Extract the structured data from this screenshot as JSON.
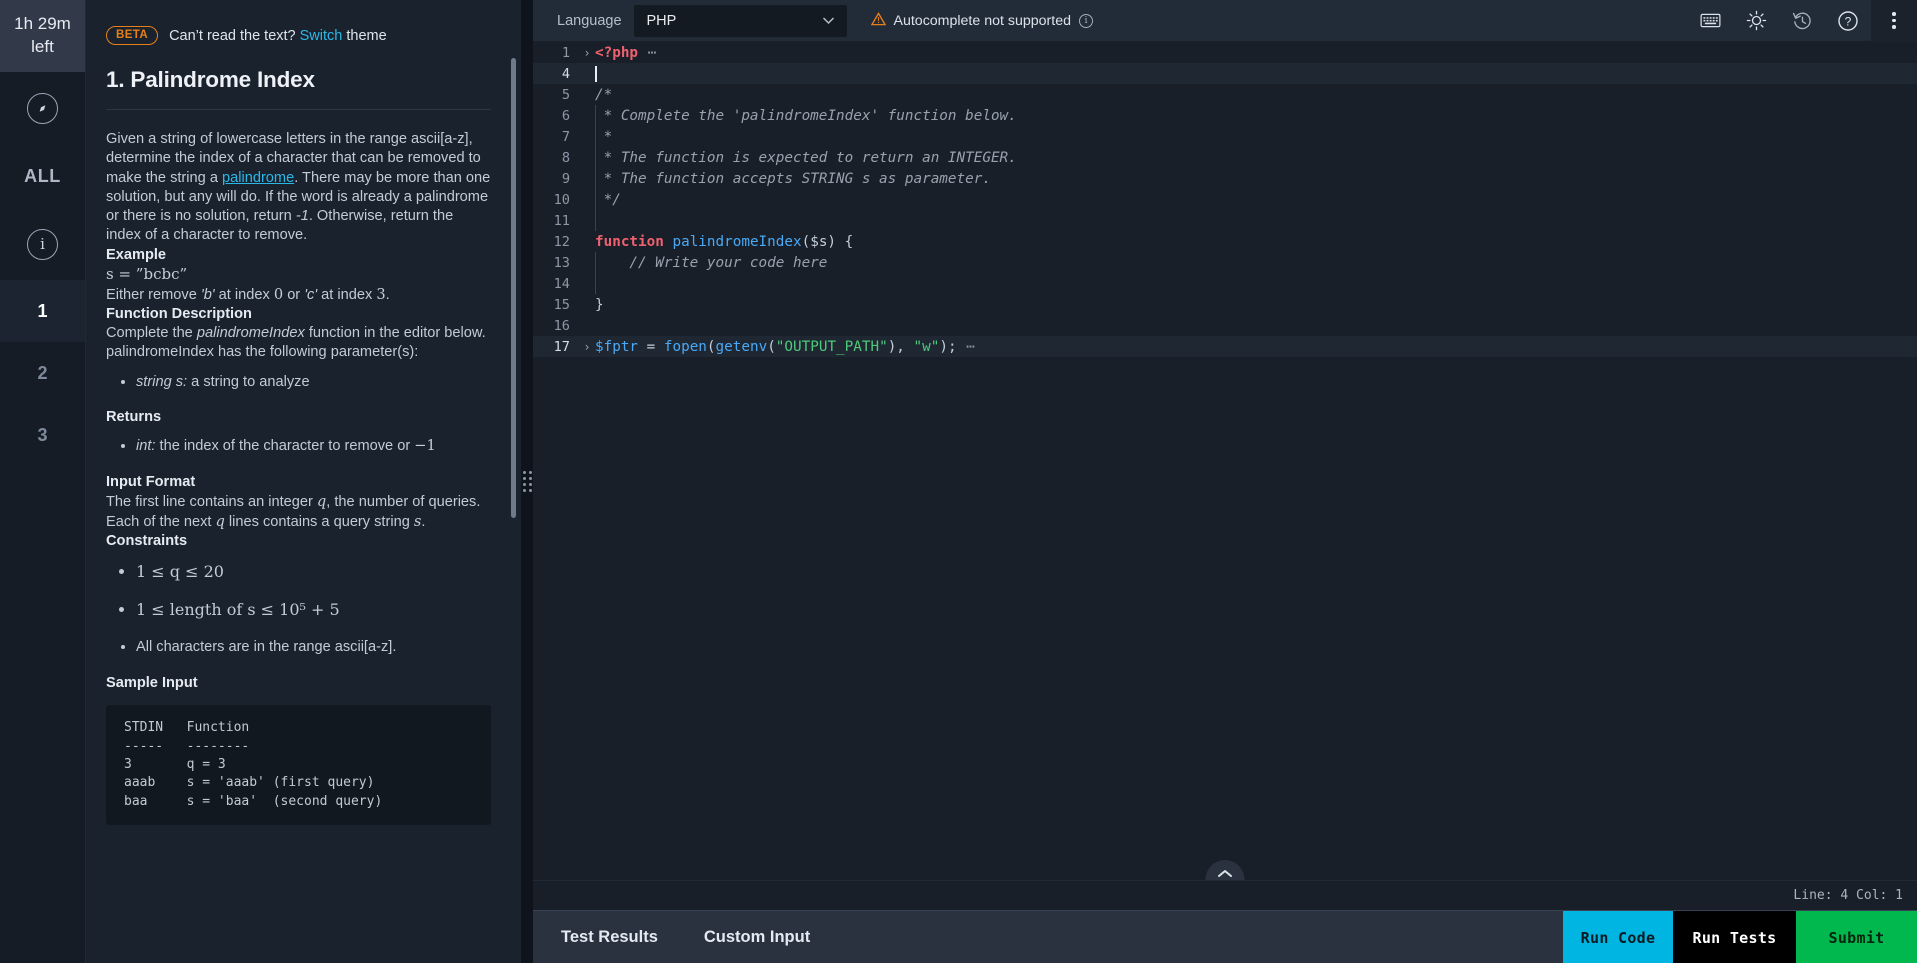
{
  "rail": {
    "timer": "1h 29m\nleft",
    "compass_icon": "compass-icon",
    "all_label": "ALL",
    "info_icon": "info-icon",
    "questions": [
      {
        "label": "1",
        "active": true
      },
      {
        "label": "2",
        "active": false
      },
      {
        "label": "3",
        "active": false
      }
    ]
  },
  "problem": {
    "beta_badge": "BETA",
    "beta_prefix": "Can’t read the text? ",
    "beta_link": "Switch",
    "beta_suffix": " theme",
    "title": "1. Palindrome Index",
    "intro_a": "Given a string of lowercase letters in the range ascii[a-z], determine the index of a character that can be removed to make the string a ",
    "intro_link": "palindrome",
    "intro_b": ". There may be more than one solution, but any will do. If the word is already a palindrome or there is no solution, return ",
    "intro_neg1": "-1",
    "intro_c": ". Otherwise, return the index of a character to remove.",
    "example_heading": "Example",
    "example_eq": "s = ”bcbc”",
    "example_text_a": "Either remove ",
    "example_b_char": "'b'",
    "example_text_b": " at index ",
    "example_idx0": "0",
    "example_text_c": " or ",
    "example_c_char": "'c'",
    "example_text_d": " at index ",
    "example_idx3": "3",
    "example_text_e": ".",
    "funcdesc_heading": "Function Description",
    "funcdesc_a": "Complete the ",
    "funcdesc_fn": "palindromeIndex",
    "funcdesc_b": " function in the editor below. palindromeIndex has the following parameter(s):",
    "param_em": "string s:",
    "param_rest": " a string to analyze",
    "returns_heading": "Returns",
    "returns_em": "int:",
    "returns_rest": " the index of the character to remove or ",
    "returns_val": "−1",
    "inputformat_heading": "Input Format",
    "inputformat_a": "The first line contains an integer ",
    "inputformat_q1": "q",
    "inputformat_b": ", the number of queries. Each of the next ",
    "inputformat_q2": "q",
    "inputformat_c": " lines contains a query string ",
    "inputformat_s": "s",
    "inputformat_d": ".",
    "constraints_heading": "Constraints",
    "constraint_1": "1 ≤ q ≤ 20",
    "constraint_2": "1 ≤ length of s ≤ 10⁵ + 5",
    "constraint_3": "All characters are in the range ascii[a-z].",
    "sampleinput_heading": "Sample Input",
    "sample_code": "STDIN   Function\n-----   --------\n3       q = 3\naaab    s = 'aaab' (first query)\nbaa     s = 'baa'  (second query)"
  },
  "editor": {
    "language_label": "Language",
    "language_value": "PHP",
    "autocomplete_warning": "Autocomplete not supported",
    "warning_icon": "warning-triangle-icon",
    "info_icon": "info-circle-icon",
    "toolbar_icons": [
      "keyboard-icon",
      "brightness-icon",
      "history-icon",
      "help-icon",
      "kebab-menu-icon"
    ],
    "code": [
      {
        "num": "1",
        "fold": "›",
        "highlight": false,
        "indent": false,
        "tokens": [
          {
            "t": "kw",
            "v": "<?php"
          },
          {
            "t": "dots",
            "v": " ⋯"
          }
        ]
      },
      {
        "num": "4",
        "fold": "",
        "highlight": true,
        "indent": false,
        "cursor": true,
        "tokens": []
      },
      {
        "num": "5",
        "fold": "",
        "highlight": false,
        "indent": false,
        "tokens": [
          {
            "t": "cm",
            "v": "/*"
          }
        ]
      },
      {
        "num": "6",
        "fold": "",
        "highlight": false,
        "indent": true,
        "tokens": [
          {
            "t": "cm",
            "v": " * Complete the 'palindromeIndex' function below."
          }
        ]
      },
      {
        "num": "7",
        "fold": "",
        "highlight": false,
        "indent": true,
        "tokens": [
          {
            "t": "cm",
            "v": " *"
          }
        ]
      },
      {
        "num": "8",
        "fold": "",
        "highlight": false,
        "indent": true,
        "tokens": [
          {
            "t": "cm",
            "v": " * The function is expected to return an INTEGER."
          }
        ]
      },
      {
        "num": "9",
        "fold": "",
        "highlight": false,
        "indent": true,
        "tokens": [
          {
            "t": "cm",
            "v": " * The function accepts STRING s as parameter."
          }
        ]
      },
      {
        "num": "10",
        "fold": "",
        "highlight": false,
        "indent": true,
        "tokens": [
          {
            "t": "cm",
            "v": " */"
          }
        ]
      },
      {
        "num": "11",
        "fold": "",
        "highlight": false,
        "indent": true,
        "tokens": []
      },
      {
        "num": "12",
        "fold": "",
        "highlight": false,
        "indent": false,
        "tokens": [
          {
            "t": "kw",
            "v": "function"
          },
          {
            "t": "var",
            "v": " "
          },
          {
            "t": "fn",
            "v": "palindromeIndex"
          },
          {
            "t": "var",
            "v": "($s) {"
          }
        ]
      },
      {
        "num": "13",
        "fold": "",
        "highlight": false,
        "indent": true,
        "tokens": [
          {
            "t": "cm",
            "v": "    // Write your code here"
          }
        ]
      },
      {
        "num": "14",
        "fold": "",
        "highlight": false,
        "indent": true,
        "tokens": []
      },
      {
        "num": "15",
        "fold": "",
        "highlight": false,
        "indent": false,
        "tokens": [
          {
            "t": "var",
            "v": "}"
          }
        ]
      },
      {
        "num": "16",
        "fold": "",
        "highlight": false,
        "indent": false,
        "tokens": []
      },
      {
        "num": "17",
        "fold": "›",
        "highlight": true,
        "indent": false,
        "tokens": [
          {
            "t": "fn",
            "v": "$fptr"
          },
          {
            "t": "var",
            "v": " = "
          },
          {
            "t": "fn",
            "v": "fopen"
          },
          {
            "t": "var",
            "v": "("
          },
          {
            "t": "fn",
            "v": "getenv"
          },
          {
            "t": "var",
            "v": "("
          },
          {
            "t": "str",
            "v": "\"OUTPUT_PATH\""
          },
          {
            "t": "var",
            "v": "), "
          },
          {
            "t": "str",
            "v": "\"w\""
          },
          {
            "t": "var",
            "v": ");"
          },
          {
            "t": "dots",
            "v": " ⋯"
          }
        ]
      }
    ],
    "status": "Line: 4 Col: 1",
    "collapse_icon": "chevron-up-icon"
  },
  "bottom": {
    "tabs": [
      {
        "label": "Test Results"
      },
      {
        "label": "Custom Input"
      }
    ],
    "run_code": "Run Code",
    "run_tests": "Run Tests",
    "submit": "Submit",
    "colors": {
      "run_code": "#00b5e2",
      "run_tests": "#000000",
      "submit": "#00b84d",
      "accent_orange": "#e8801a",
      "accent_blue": "#2bb8e8"
    }
  }
}
